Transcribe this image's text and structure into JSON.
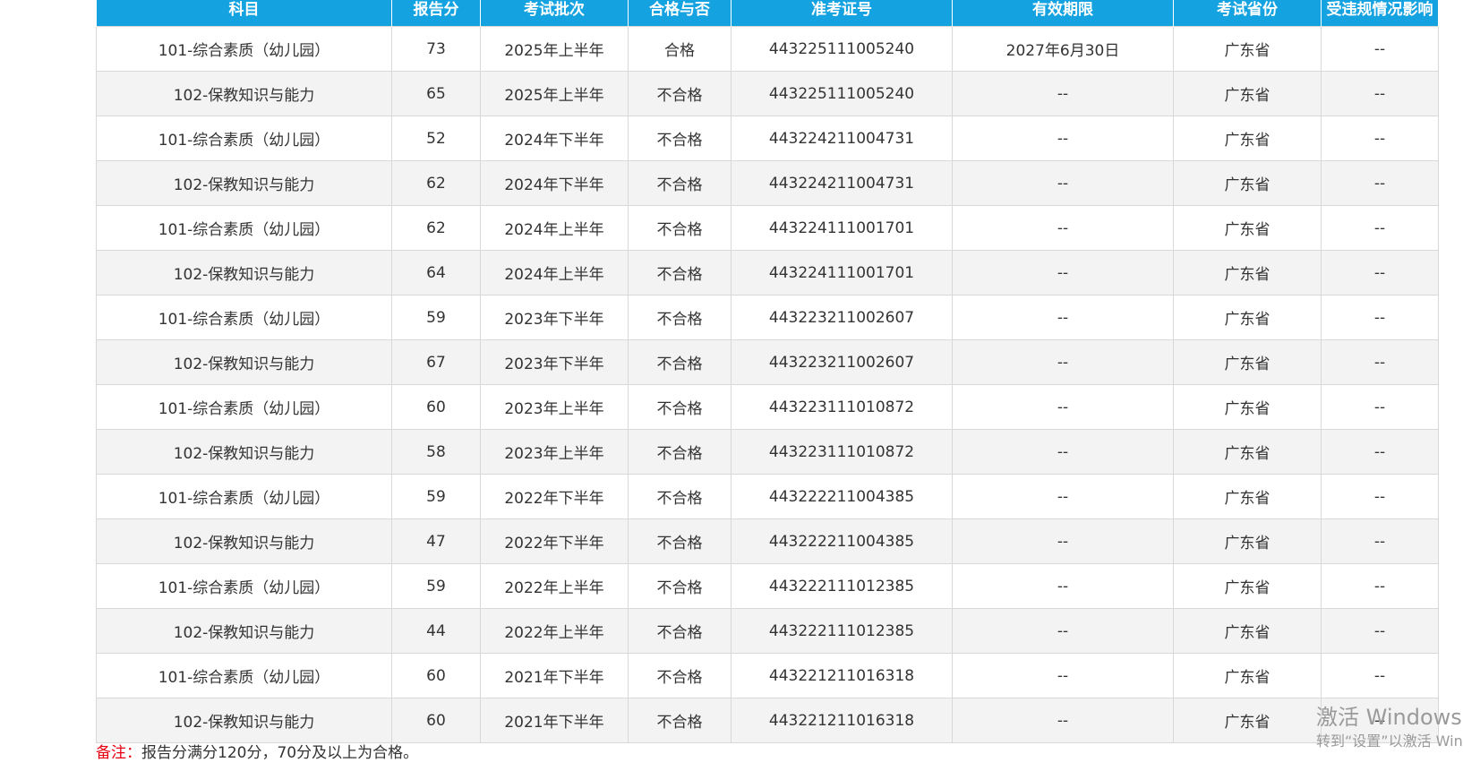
{
  "table": {
    "headers": [
      "科目",
      "报告分",
      "考试批次",
      "合格与否",
      "准考证号",
      "有效期限",
      "考试省份",
      "受违规情况影响"
    ],
    "rows": [
      [
        "101-综合素质（幼儿园）",
        "73",
        "2025年上半年",
        "合格",
        "443225111005240",
        "2027年6月30日",
        "广东省",
        "--"
      ],
      [
        "102-保教知识与能力",
        "65",
        "2025年上半年",
        "不合格",
        "443225111005240",
        "--",
        "广东省",
        "--"
      ],
      [
        "101-综合素质（幼儿园）",
        "52",
        "2024年下半年",
        "不合格",
        "443224211004731",
        "--",
        "广东省",
        "--"
      ],
      [
        "102-保教知识与能力",
        "62",
        "2024年下半年",
        "不合格",
        "443224211004731",
        "--",
        "广东省",
        "--"
      ],
      [
        "101-综合素质（幼儿园）",
        "62",
        "2024年上半年",
        "不合格",
        "443224111001701",
        "--",
        "广东省",
        "--"
      ],
      [
        "102-保教知识与能力",
        "64",
        "2024年上半年",
        "不合格",
        "443224111001701",
        "--",
        "广东省",
        "--"
      ],
      [
        "101-综合素质（幼儿园）",
        "59",
        "2023年下半年",
        "不合格",
        "443223211002607",
        "--",
        "广东省",
        "--"
      ],
      [
        "102-保教知识与能力",
        "67",
        "2023年下半年",
        "不合格",
        "443223211002607",
        "--",
        "广东省",
        "--"
      ],
      [
        "101-综合素质（幼儿园）",
        "60",
        "2023年上半年",
        "不合格",
        "443223111010872",
        "--",
        "广东省",
        "--"
      ],
      [
        "102-保教知识与能力",
        "58",
        "2023年上半年",
        "不合格",
        "443223111010872",
        "--",
        "广东省",
        "--"
      ],
      [
        "101-综合素质（幼儿园）",
        "59",
        "2022年下半年",
        "不合格",
        "443222211004385",
        "--",
        "广东省",
        "--"
      ],
      [
        "102-保教知识与能力",
        "47",
        "2022年下半年",
        "不合格",
        "443222211004385",
        "--",
        "广东省",
        "--"
      ],
      [
        "101-综合素质（幼儿园）",
        "59",
        "2022年上半年",
        "不合格",
        "443222111012385",
        "--",
        "广东省",
        "--"
      ],
      [
        "102-保教知识与能力",
        "44",
        "2022年上半年",
        "不合格",
        "443222111012385",
        "--",
        "广东省",
        "--"
      ],
      [
        "101-综合素质（幼儿园）",
        "60",
        "2021年下半年",
        "不合格",
        "443221211016318",
        "--",
        "广东省",
        "--"
      ],
      [
        "102-保教知识与能力",
        "60",
        "2021年下半年",
        "不合格",
        "443221211016318",
        "--",
        "广东省",
        "--"
      ]
    ]
  },
  "note": {
    "label": "备注：",
    "text": "报告分满分120分，70分及以上为合格。"
  },
  "watermark": {
    "title": "激活 Windows",
    "subtitle": "转到“设置”以激活 Windows。"
  }
}
